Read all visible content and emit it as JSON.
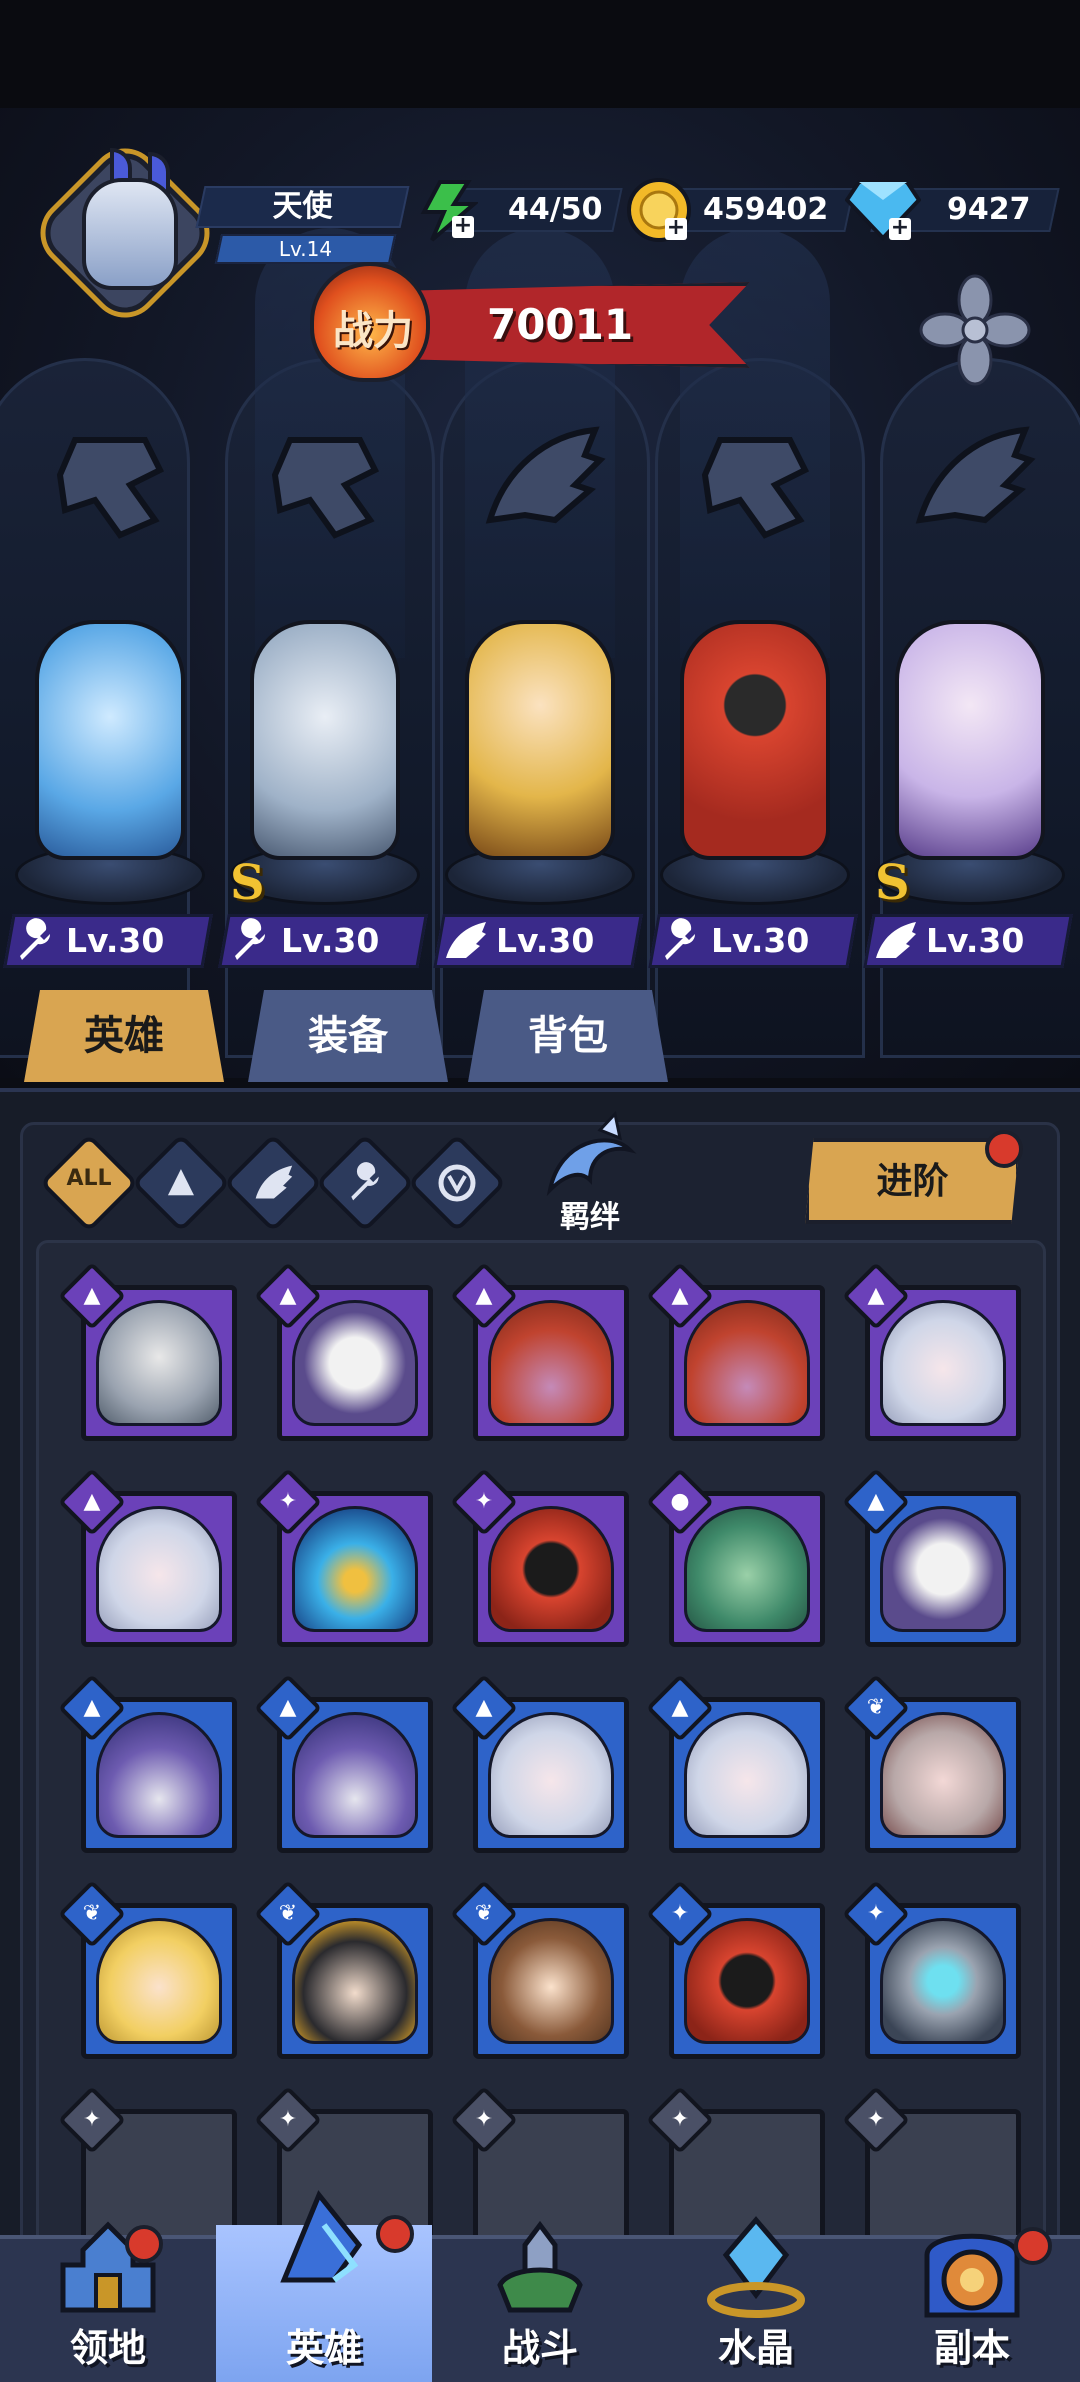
{
  "player": {
    "name": "天使",
    "level": "Lv.14"
  },
  "resources": {
    "energy": "44/50",
    "gold": "459402",
    "diamond": "9427"
  },
  "power": {
    "label": "战力",
    "value": "70011"
  },
  "emblems": [
    "wrench-emblem",
    "wrench-emblem",
    "wing-emblem",
    "wrench-emblem",
    "wing-emblem"
  ],
  "heroes": [
    {
      "level": "Lv.30",
      "class": "wrench",
      "rarity": "",
      "body_color": "#5aa8e6"
    },
    {
      "level": "Lv.30",
      "class": "wrench",
      "rarity": "S",
      "body_color": "#9fb2c8"
    },
    {
      "level": "Lv.30",
      "class": "wing",
      "rarity": "",
      "body_color": "#e3b64a"
    },
    {
      "level": "Lv.30",
      "class": "wrench",
      "rarity": "",
      "body_color": "#d8442f"
    },
    {
      "level": "Lv.30",
      "class": "wing",
      "rarity": "S",
      "body_color": "#c9b5e8"
    }
  ],
  "tabs": {
    "heroes": "英雄",
    "equipment": "装备",
    "backpack": "背包"
  },
  "filters": {
    "all": "ALL"
  },
  "bond": {
    "label": "羁绊"
  },
  "advance": {
    "label": "进阶"
  },
  "nav": {
    "territory": "领地",
    "heroes": "英雄",
    "battle": "战斗",
    "crystal": "水晶",
    "dungeon": "副本"
  },
  "colors": {
    "accent_gold": "#d9a551",
    "card_purple": "#6b41b9",
    "card_blue": "#2e63c9",
    "power_red": "#b1262a",
    "notification_red": "#d83a2c"
  }
}
